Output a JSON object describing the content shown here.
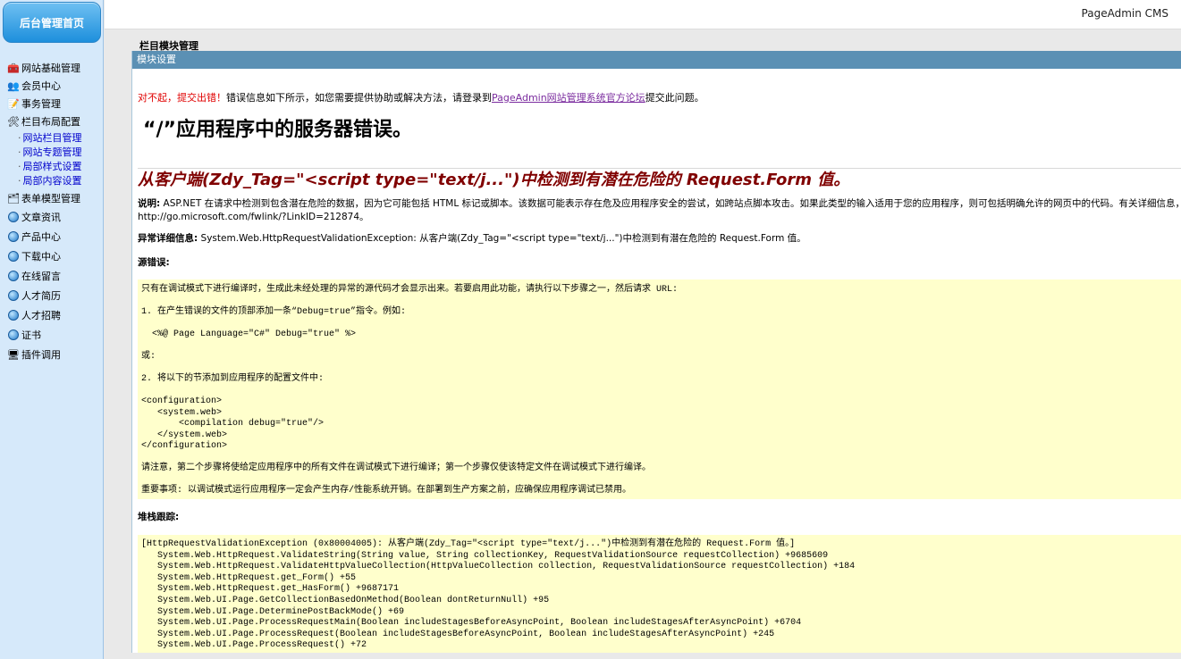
{
  "sidebar": {
    "home_button": "后台管理首页",
    "items": [
      {
        "label": "网站基础管理",
        "icon": "toolbox-icon"
      },
      {
        "label": "会员中心",
        "icon": "user-group-icon"
      },
      {
        "label": "事务管理",
        "icon": "notepad-icon"
      },
      {
        "label": "栏目布局配置",
        "icon": "tools-icon"
      },
      {
        "label": "表单模型管理",
        "icon": "form-icon"
      },
      {
        "label": "文章资讯",
        "icon": "globe-icon"
      },
      {
        "label": "产品中心",
        "icon": "globe-icon"
      },
      {
        "label": "下载中心",
        "icon": "globe-icon"
      },
      {
        "label": "在线留言",
        "icon": "globe-icon"
      },
      {
        "label": "人才简历",
        "icon": "globe-icon"
      },
      {
        "label": "人才招聘",
        "icon": "globe-icon"
      },
      {
        "label": "证书",
        "icon": "globe-icon"
      },
      {
        "label": "插件调用",
        "icon": "plugin-icon"
      }
    ],
    "sub_items": [
      "网站栏目管理",
      "网站专题管理",
      "局部样式设置",
      "局部内容设置"
    ]
  },
  "topbar": {
    "brand": "PageAdmin CMS"
  },
  "page_title": "栏目模块管理",
  "panel": {
    "header": "模块设置",
    "intro_red": "对不起，提交出错！",
    "intro_text": "错误信息如下所示，如您需要提供协助或解决方法，请登录到",
    "intro_link": "PageAdmin网站管理系统官方论坛",
    "intro_tail": "提交此问题。",
    "h1": "“/”应用程序中的服务器错误。",
    "h2": "从客户端(Zdy_Tag=\"<script type=\"text/j...\")中检测到有潜在危险的 Request.Form 值。",
    "desc_label": "说明:",
    "desc_text": " ASP.NET 在请求中检测到包含潜在危险的数据，因为它可能包括 HTML 标记或脚本。该数据可能表示存在危及应用程序安全的尝试，如跨站点脚本攻击。如果此类型的输入适用于您的应用程序，则可包括明确允许的网页中的代码。有关详细信息，请参阅",
    "desc_link": "http://go.microsoft.com/fwlink/?LinkID=212874。",
    "exc_label": "异常详细信息:",
    "exc_text": " System.Web.HttpRequestValidationException: 从客户端(Zdy_Tag=\"<script type=\"text/j...\")中检测到有潜在危险的 Request.Form 值。",
    "src_label": "源错误:",
    "src_lines": [
      "只有在调试模式下进行编译时，生成此未经处理的异常的源代码才会显示出来。若要启用此功能，请执行以下步骤之一，然后请求 URL:",
      "1. 在产生错误的文件的顶部添加一条“Debug=true”指令。例如:",
      "  <%@ Page Language=\"C#\" Debug=\"true\" %>",
      "或:",
      "2. 将以下的节添加到应用程序的配置文件中:",
      "<configuration>\n   <system.web>\n       <compilation debug=\"true\"/>\n   </system.web>\n</configuration>",
      "请注意，第二个步骤将使给定应用程序中的所有文件在调试模式下进行编译；第一个步骤仅使该特定文件在调试模式下进行编译。",
      "重要事项: 以调试模式运行应用程序一定会产生内存/性能系统开销。在部署到生产方案之前，应确保应用程序调试已禁用。"
    ],
    "stack_label": "堆栈跟踪:",
    "stack_lines": [
      "[HttpRequestValidationException (0x80004005): 从客户端(Zdy_Tag=\"<script type=\"text/j...\")中检测到有潜在危险的 Request.Form 值。]",
      "   System.Web.HttpRequest.ValidateString(String value, String collectionKey, RequestValidationSource requestCollection) +9685609",
      "   System.Web.HttpRequest.ValidateHttpValueCollection(HttpValueCollection collection, RequestValidationSource requestCollection) +184",
      "   System.Web.HttpRequest.get_Form() +55",
      "   System.Web.HttpRequest.get_HasForm() +9687171",
      "   System.Web.UI.Page.GetCollectionBasedOnMethod(Boolean dontReturnNull) +95",
      "   System.Web.UI.Page.DeterminePostBackMode() +69",
      "   System.Web.UI.Page.ProcessRequestMain(Boolean includeStagesBeforeAsyncPoint, Boolean includeStagesAfterAsyncPoint) +6704",
      "   System.Web.UI.Page.ProcessRequest(Boolean includeStagesBeforeAsyncPoint, Boolean includeStagesAfterAsyncPoint) +245",
      "   System.Web.UI.Page.ProcessRequest() +72"
    ]
  }
}
